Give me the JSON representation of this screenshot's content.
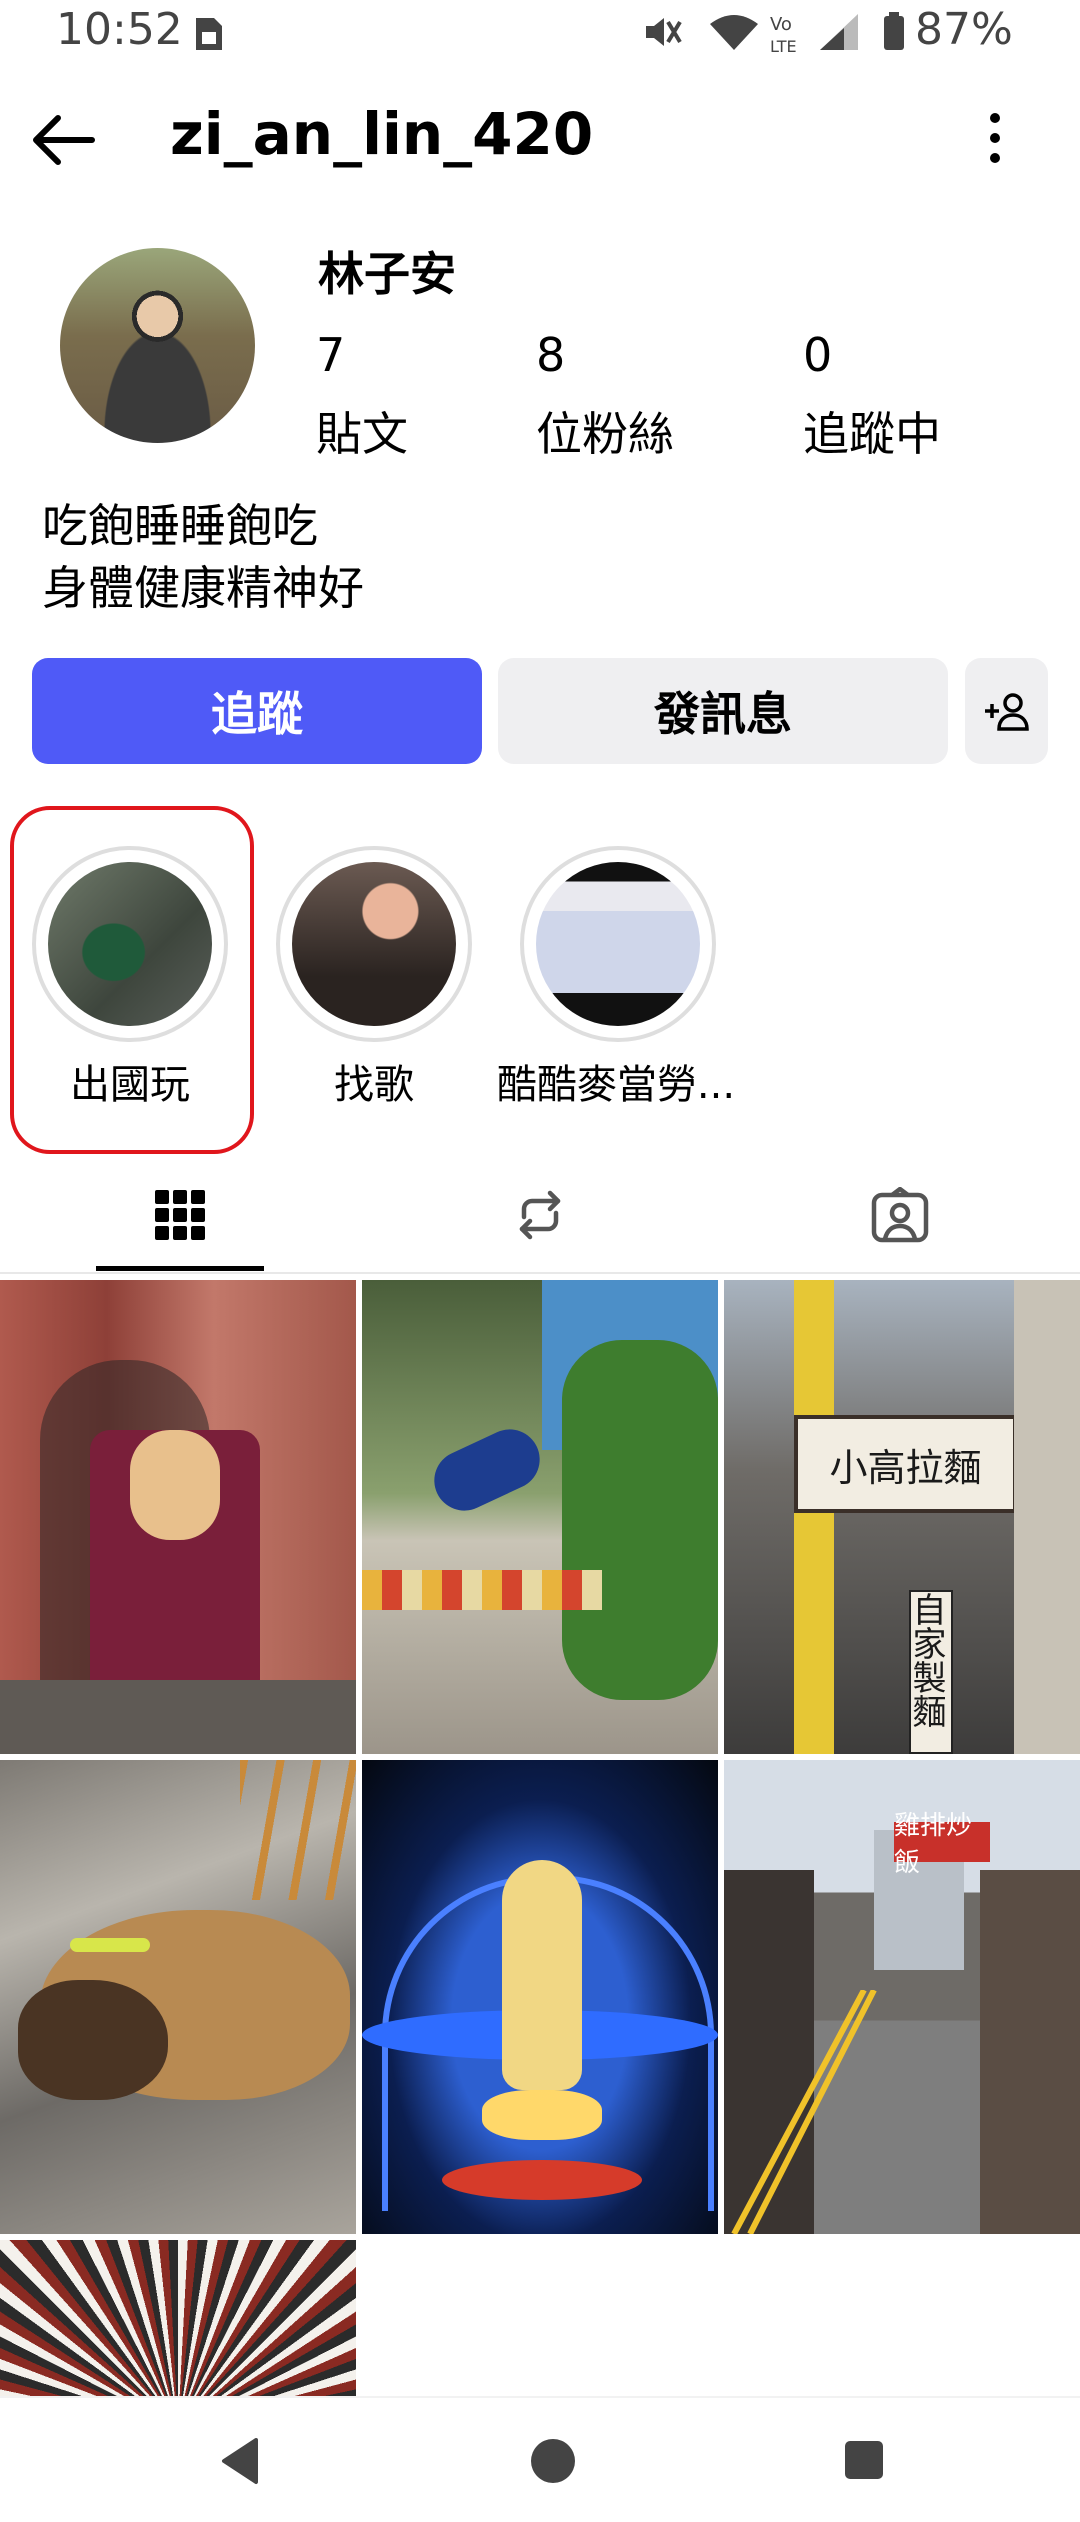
{
  "status_bar": {
    "time": "10:52",
    "battery": "87%"
  },
  "header": {
    "username": "zi_an_lin_420"
  },
  "profile": {
    "name": "林子安",
    "stats": [
      {
        "value": "7",
        "label": "貼文"
      },
      {
        "value": "8",
        "label": "位粉絲"
      },
      {
        "value": "0",
        "label": "追蹤中"
      }
    ],
    "bio": [
      "吃飽睡睡飽吃",
      "身體健康精神好"
    ]
  },
  "actions": {
    "follow": "追蹤",
    "message": "發訊息"
  },
  "highlights": [
    {
      "label": "出國玩"
    },
    {
      "label": "找歌"
    },
    {
      "label": "酷酷麥當勞..."
    }
  ],
  "tabs": [
    "grid-icon",
    "reels-icon",
    "tagged-icon"
  ],
  "grid_posts": [
    {
      "desc": "mural"
    },
    {
      "desc": "bird"
    },
    {
      "desc": "street-shops"
    },
    {
      "desc": "dog"
    },
    {
      "desc": "lantern"
    },
    {
      "desc": "street"
    },
    {
      "desc": "books"
    }
  ],
  "photo_text": {
    "sign_main": "小高拉麵",
    "sign_side": "自家製麵",
    "sign_shop": "雞排炒飯"
  }
}
